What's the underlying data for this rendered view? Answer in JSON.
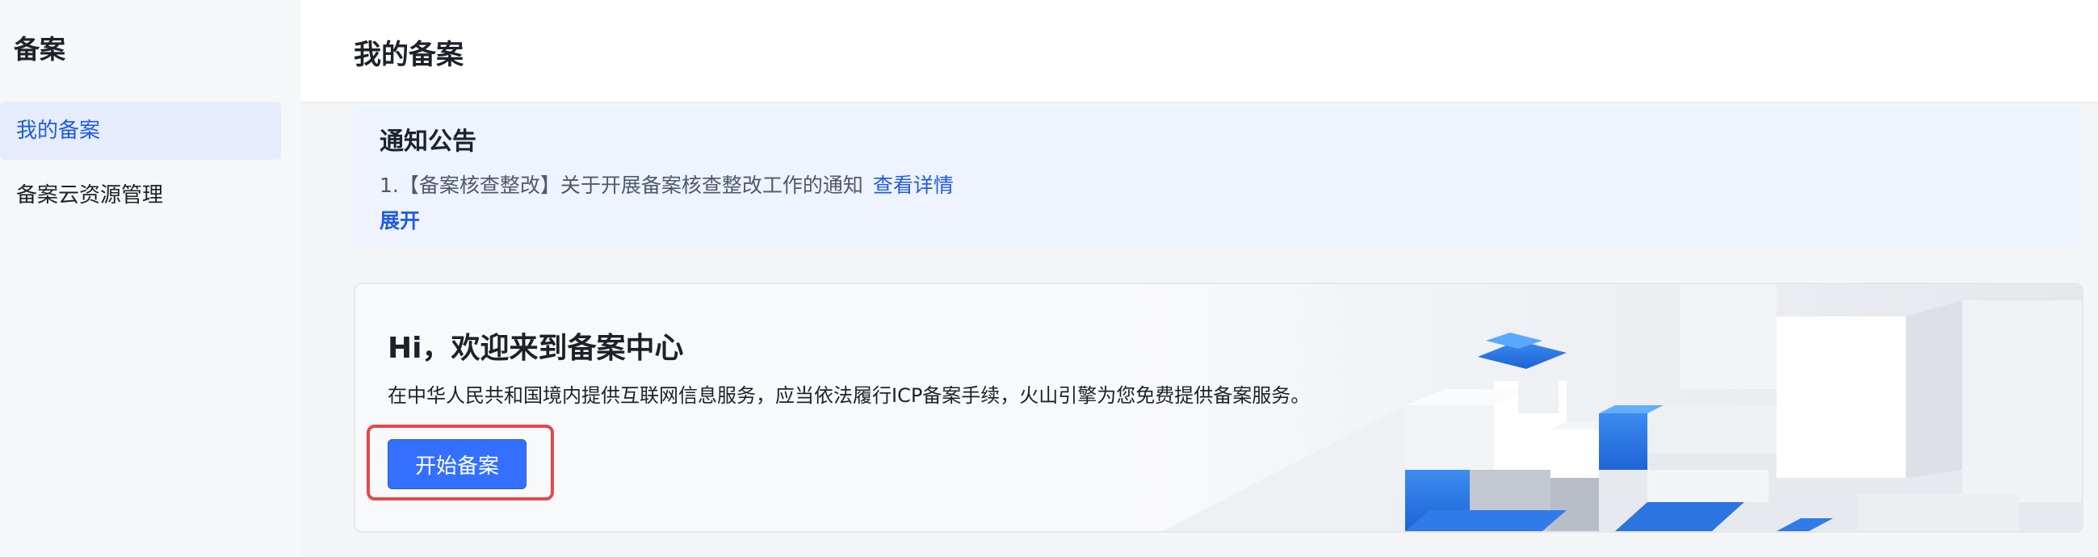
{
  "sidebar": {
    "title": "备案",
    "items": [
      {
        "label": "我的备案"
      },
      {
        "label": "备案云资源管理"
      }
    ]
  },
  "header": {
    "title": "我的备案"
  },
  "notice": {
    "title": "通知公告",
    "line1_text": "1.【备案核查整改】关于开展备案核查整改工作的通知",
    "line1_link": "查看详情",
    "expand_label": "展开"
  },
  "welcome": {
    "title": "Hi，欢迎来到备案中心",
    "description": "在中华人民共和国境内提供互联网信息服务，应当依法履行ICP备案手续，火山引擎为您免费提供备案服务。",
    "start_button": "开始备案"
  },
  "colors": {
    "accent": "#3370ff",
    "link": "#1f5ce6",
    "highlight": "#e5484d"
  }
}
